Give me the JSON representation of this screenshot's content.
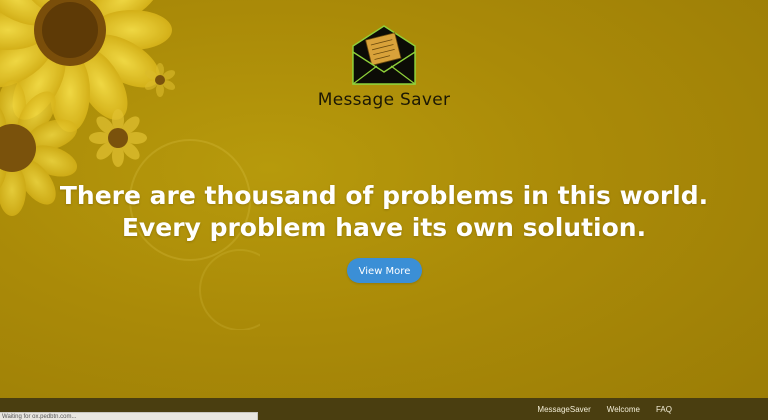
{
  "logo": {
    "text": "Message Saver",
    "icon": "envelope-icon"
  },
  "hero": {
    "line1": "There are thousand of problems in this world.",
    "line2": "Every problem have its own solution.",
    "cta_label": "View More"
  },
  "footer": {
    "nav": [
      "MessageSaver",
      "Welcome",
      "FAQ"
    ]
  },
  "status_bar": {
    "text": "Waiting for ox.pedbtn.com..."
  },
  "colors": {
    "background": "#aa8a08",
    "cta": "#3b8fd6",
    "footer": "#4a3e10",
    "headline": "#ffffff"
  }
}
